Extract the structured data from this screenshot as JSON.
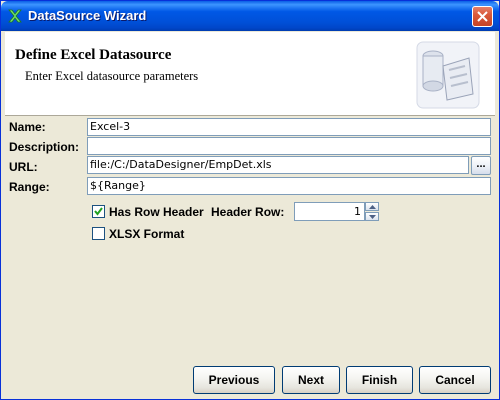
{
  "window": {
    "title": "DataSource Wizard"
  },
  "header": {
    "title": "Define Excel Datasource",
    "subtitle": "Enter Excel datasource parameters"
  },
  "form": {
    "name_label": "Name:",
    "name_value": "Excel-3",
    "description_label": "Description:",
    "description_value": "",
    "url_label": "URL:",
    "url_value": "file:/C:/DataDesigner/EmpDet.xls",
    "browse_label": "...",
    "range_label": "Range:",
    "range_value": "${Range}",
    "has_row_header_label": "Has Row Header",
    "has_row_header_checked": true,
    "header_row_label": "Header Row:",
    "header_row_value": "1",
    "xlsx_format_label": "XLSX Format",
    "xlsx_format_checked": false
  },
  "buttons": {
    "previous": "Previous",
    "next": "Next",
    "finish": "Finish",
    "cancel": "Cancel"
  },
  "colors": {
    "titlebar": "#0054E3",
    "close_button": "#D9593B",
    "dialog_bg": "#ECE9D8"
  },
  "icons": {
    "title": "wizard-icon",
    "close": "close-icon",
    "header": "datasource-graphic-icon"
  }
}
